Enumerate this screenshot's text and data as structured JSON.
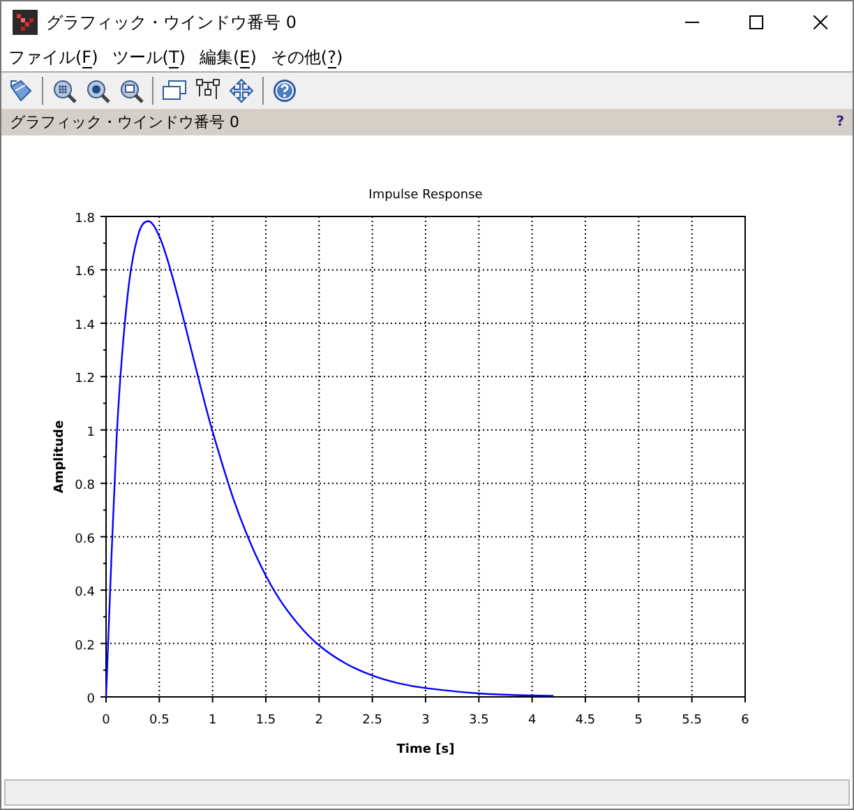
{
  "window": {
    "title": "グラフィック・ウインドウ番号 0"
  },
  "menu": [
    {
      "label": "ファイル(F)"
    },
    {
      "label": "ツール(T)"
    },
    {
      "label": "編集(E)"
    },
    {
      "label": "その他(?)"
    }
  ],
  "figure_bar": {
    "label": "グラフィック・ウインドウ番号 0",
    "help": "?"
  },
  "chart_data": {
    "type": "line",
    "grid": true,
    "title": "Impulse Response",
    "xlabel": "Time [s]",
    "ylabel": "Amplitude",
    "x": [
      0,
      0.1,
      0.2,
      0.3,
      0.4,
      0.5,
      0.6,
      0.7,
      0.8,
      0.9,
      1,
      1.2,
      1.4,
      1.6,
      1.8,
      2,
      2.25,
      2.5,
      2.75,
      3,
      3.5,
      4,
      4.2
    ],
    "series": [
      {
        "color": "#0000ff",
        "values": [
          0,
          0.974,
          1.497,
          1.729,
          1.782,
          1.725,
          1.607,
          1.459,
          1.3,
          1.143,
          0.995,
          0.737,
          0.536,
          0.384,
          0.274,
          0.193,
          0.125,
          0.08,
          0.051,
          0.033,
          0.013,
          0.005,
          0.004
        ]
      }
    ],
    "xlim": [
      0,
      6
    ],
    "ylim": [
      0,
      1.8
    ],
    "xticks": [
      0,
      0.5,
      1,
      1.5,
      2,
      2.5,
      3,
      3.5,
      4,
      4.5,
      5,
      5.5,
      6
    ],
    "yticks": [
      0,
      0.2,
      0.4,
      0.6,
      0.8,
      1,
      1.2,
      1.4,
      1.6,
      1.8
    ]
  }
}
